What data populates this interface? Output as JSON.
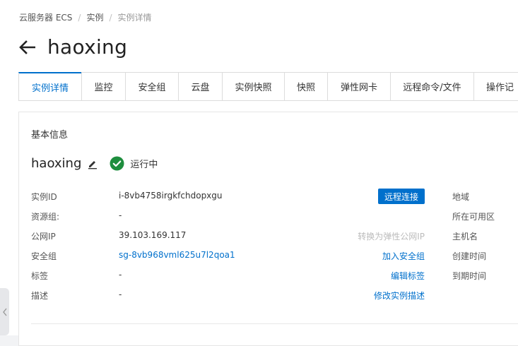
{
  "breadcrumb": {
    "items": [
      "云服务器 ECS",
      "实例"
    ],
    "current": "实例详情"
  },
  "page_title": "haoxing",
  "tabs": [
    {
      "label": "实例详情"
    },
    {
      "label": "监控"
    },
    {
      "label": "安全组"
    },
    {
      "label": "云盘"
    },
    {
      "label": "实例快照"
    },
    {
      "label": "快照"
    },
    {
      "label": "弹性网卡"
    },
    {
      "label": "远程命令/文件"
    },
    {
      "label": "操作记"
    }
  ],
  "section_title": "基本信息",
  "instance": {
    "name": "haoxing",
    "status": "运行中",
    "status_color": "#1e8e3e"
  },
  "info": [
    {
      "label": "实例ID",
      "value": "i-8vb4758irgkfchdopxgu"
    },
    {
      "label": "资源组:",
      "value": "-"
    },
    {
      "label": "公网IP",
      "value": "39.103.169.117"
    },
    {
      "label": "安全组",
      "value": "sg-8vb968vml625u7l2qoa1"
    },
    {
      "label": "标签",
      "value": "-"
    },
    {
      "label": "描述",
      "value": "-"
    }
  ],
  "actions": {
    "remote_connect": "远程连接",
    "convert_eip": "转换为弹性公网IP",
    "join_sg": "加入安全组",
    "edit_tags": "编辑标签",
    "edit_desc": "修改实例描述"
  },
  "right_labels": [
    "地域",
    "所在可用区",
    "主机名",
    "创建时间",
    "到期时间"
  ],
  "colors": {
    "accent": "#0070cc",
    "success": "#1e8e3e"
  }
}
